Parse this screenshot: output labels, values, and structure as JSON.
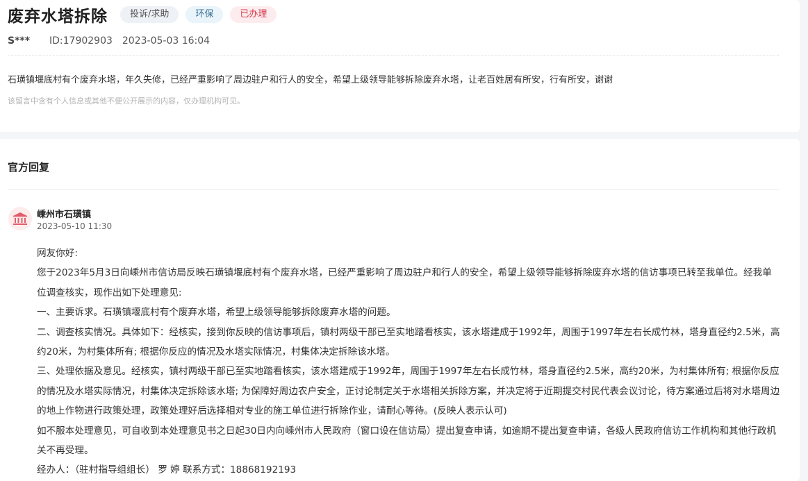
{
  "post": {
    "title": "废弃水塔拆除",
    "tags": [
      "投诉/求助",
      "环保",
      "已办理"
    ],
    "user": "S***",
    "id": "ID:17902903",
    "datetime": "2023-05-03 16:04",
    "content": "石璜镇堰底村有个废弃水塔，年久失修，已经严重影响了周边驻户和行人的安全，希望上级领导能够拆除废弃水塔，让老百姓居有所安，行有所安，谢谢",
    "privacy_notice": "该留言中含有个人信息或其他不便公开展示的内容，仅办理机构可见。"
  },
  "reply": {
    "heading": "官方回复",
    "org_icon": "government-building-icon",
    "org": "嵊州市石璜镇",
    "time": "2023-05-10 11:30",
    "paragraphs": [
      "网友你好:",
      "您于2023年5月3日向嵊州市信访局反映石璜镇堰底村有个废弃水塔，已经严重影响了周边驻户和行人的安全，希望上级领导能够拆除废弃水塔的信访事项已转至我单位。经我单位调查核实，现作出如下处理意见:",
      "一、主要诉求。石璜镇堰底村有个废弃水塔，希望上级领导能够拆除废弃水塔的问题。",
      "二、调查核实情况。具体如下：经核实，接到你反映的信访事项后，镇村两级干部已至实地踏看核实，该水塔建成于1992年，周围于1997年左右长成竹林，塔身直径约2.5米，高约20米，为村集体所有; 根据你反应的情况及水塔实际情况，村集体决定拆除该水塔。",
      "三、处理依据及意见。经核实，镇村两级干部已至实地踏看核实，该水塔建成于1992年，周围于1997年左右长成竹林，塔身直径约2.5米，高约20米，为村集体所有; 根据你反应的情况及水塔实际情况，村集体决定拆除该水塔; 为保障好周边农户安全，正讨论制定关于水塔相关拆除方案，并决定将于近期提交村民代表会议讨论，待方案通过后将对水塔周边的地上作物进行政策处理，政策处理好后选择相对专业的施工单位进行拆除作业，请耐心等待。(反映人表示认可)",
      "如不服本处理意见，可自收到本处理意见书之日起30日内向嵊州市人民政府（窗口设在信访局）提出复查申请，如逾期不提出复查申请，各级人民政府信访工作机构和其他行政机关不再受理。",
      "经办人：（驻村指导组组长） 罗 婷   联系方式：18868192193"
    ]
  },
  "colors": {
    "tag_complaint_bg": "#eef1f6",
    "tag_env_bg": "#e9f4fb",
    "tag_done_bg": "#fdecee",
    "tag_done_text": "#d23b4b",
    "avatar_icon": "#e35d6a"
  }
}
